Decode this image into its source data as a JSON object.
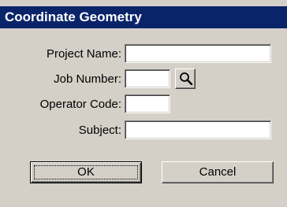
{
  "window": {
    "title": "Coordinate Geometry"
  },
  "form": {
    "project_name": {
      "label": "Project Name:",
      "value": ""
    },
    "job_number": {
      "label": "Job Number:",
      "value": ""
    },
    "operator_code": {
      "label": "Operator Code:",
      "value": ""
    },
    "subject": {
      "label": "Subject:",
      "value": ""
    }
  },
  "buttons": {
    "ok_label": "OK",
    "cancel_label": "Cancel",
    "search_icon": "magnifier-icon"
  },
  "colors": {
    "titlebar": "#0a246a",
    "dialog_bg": "#d4d0c8",
    "field_bg": "#ffffff"
  }
}
